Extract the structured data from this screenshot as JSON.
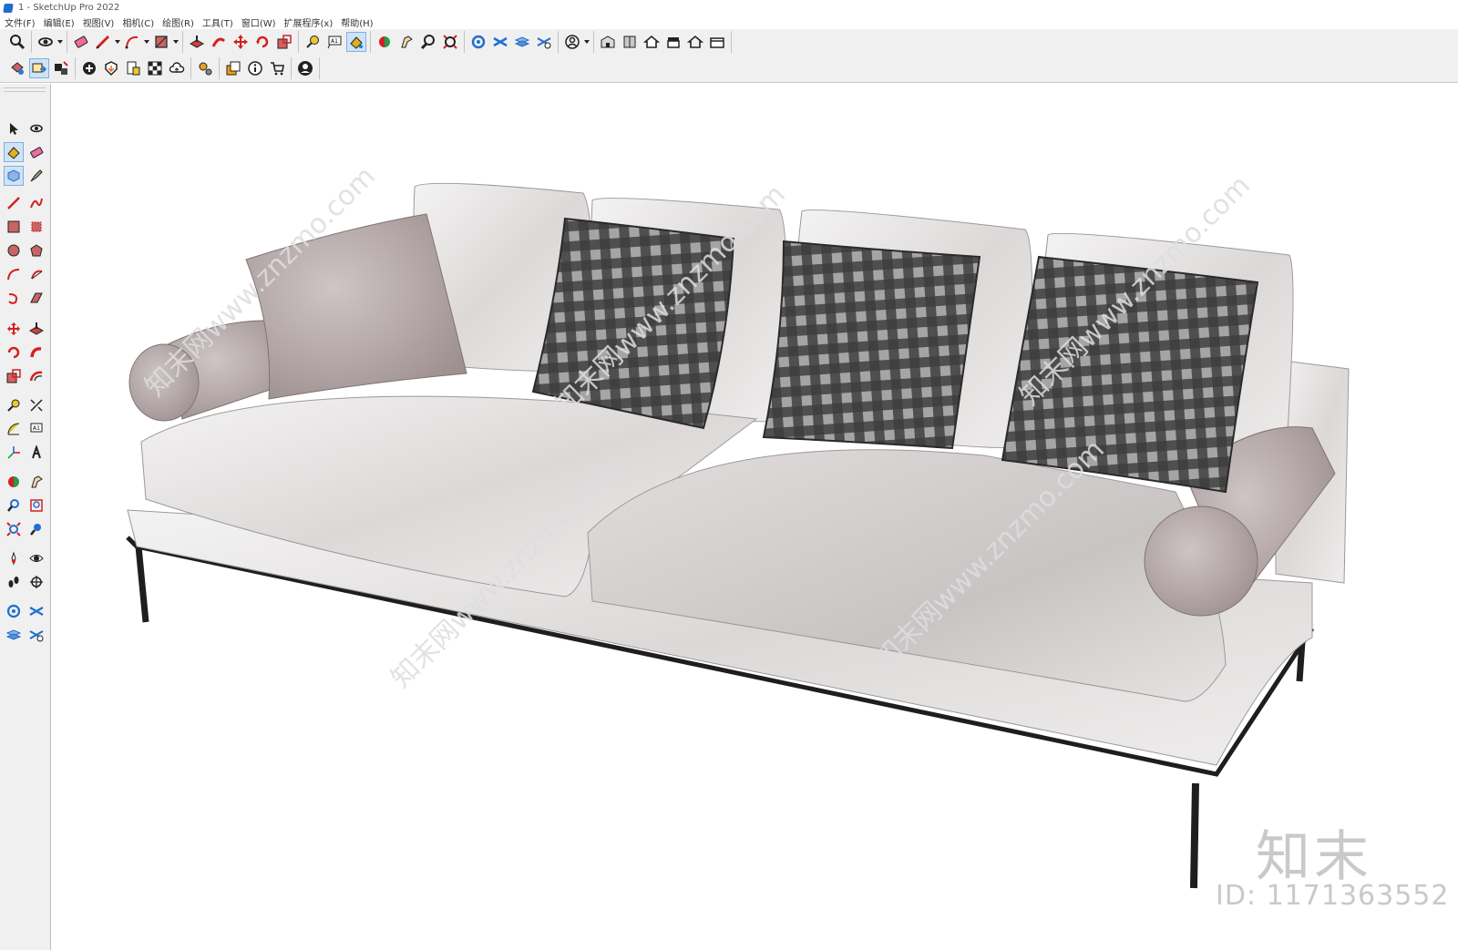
{
  "window": {
    "title": "1 - SketchUp Pro 2022"
  },
  "menu": [
    "文件(F)",
    "编辑(E)",
    "视图(V)",
    "相机(C)",
    "绘图(R)",
    "工具(T)",
    "窗口(W)",
    "扩展程序(x)",
    "帮助(H)"
  ],
  "colors": {
    "accent": "#cfe3f7",
    "red_tool": "#d42020",
    "blue_tool": "#1f6fd1",
    "sofa_fabric": "#e6e3e3",
    "pillow_mauve": "#b3a6a6",
    "plaid_dark": "#3a3a3a",
    "frame": "#1e1e1e"
  },
  "toolbar_row1_icons": [
    "zoom-icon",
    "orbit-icon",
    "eraser-icon",
    "pencil-icon",
    "arc-icon",
    "rectangle-icon",
    "pushpull-icon",
    "followme-icon",
    "move-icon",
    "rotate-icon",
    "scale-icon",
    "tape-icon",
    "text-icon",
    "paint-icon",
    "walk-icon",
    "position-camera-icon",
    "lookaround-icon",
    "zoom-window-icon",
    "zoom-extents-icon",
    "section-icon",
    "sandbox-icon",
    "layers-icon",
    "outliner-icon",
    "profile-icon",
    "warehouse-icon",
    "components-icon",
    "home-icon",
    "shop-icon",
    "house-outline-icon",
    "box-icon"
  ],
  "toolbar_row2_icons": [
    "materials-icon",
    "select-move-icon",
    "scenes-icon",
    "add-location-icon",
    "geo-icon",
    "report-icon",
    "checker-icon",
    "cloud-icon",
    "extension-manager-icon",
    "styles-icon",
    "info-icon",
    "cart-icon",
    "account-icon"
  ],
  "left_palette_icons": [
    "select-arrow-icon",
    "orbit-icon",
    "paint-bucket-icon",
    "eraser-icon",
    "components-icon",
    "tag-icon",
    "pencil-icon",
    "freehand-icon",
    "rectangle-icon",
    "rotated-rect-icon",
    "circle-icon",
    "polygon-icon",
    "arc-icon",
    "pie-icon",
    "arc3-icon",
    "pushpull-icon",
    "move-icon",
    "pushpull-alt-icon",
    "rotate-icon",
    "followme-icon",
    "scale-icon",
    "offset-icon",
    "tape-icon",
    "dimension-icon",
    "protractor-icon",
    "text-icon",
    "axes-icon",
    "3dtext-icon",
    "orbit2-icon",
    "pan-icon",
    "zoom-icon",
    "zoom-window-icon",
    "zoom-extents-icon",
    "previous-view-icon",
    "position-camera-icon",
    "lookaround-icon",
    "walk-icon",
    "section-plane-icon",
    "display-section-icon",
    "section-cut-icon",
    "section-fill-icon",
    "section-settings-icon"
  ],
  "watermark": {
    "brand": "知末",
    "id": "ID: 1171363552",
    "diagonal": "知末网www.znzmo.com"
  }
}
